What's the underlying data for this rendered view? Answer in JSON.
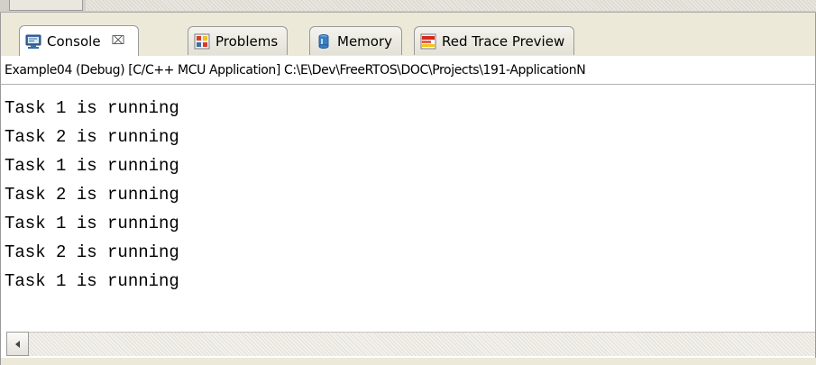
{
  "tabs": [
    {
      "label": "Console",
      "icon": "console-icon",
      "active": true,
      "close_glyph": "⌧"
    },
    {
      "label": "Problems",
      "icon": "problems-icon",
      "active": false
    },
    {
      "label": "Memory",
      "icon": "memory-icon",
      "active": false
    },
    {
      "label": "Red Trace Preview",
      "icon": "red-trace-icon",
      "active": false
    }
  ],
  "console": {
    "description": "Example04 (Debug) [C/C++ MCU Application] C:\\E\\Dev\\FreeRTOS\\DOC\\Projects\\191-ApplicationN",
    "lines": [
      "Task 1 is running",
      "Task 2 is running",
      "Task 1 is running",
      "Task 2 is running",
      "Task 1 is running",
      "Task 2 is running",
      "Task 1 is running"
    ]
  },
  "colors": {
    "panel_bg": "#ece9d8",
    "content_bg": "#ffffff",
    "border": "#9a9a9a"
  }
}
